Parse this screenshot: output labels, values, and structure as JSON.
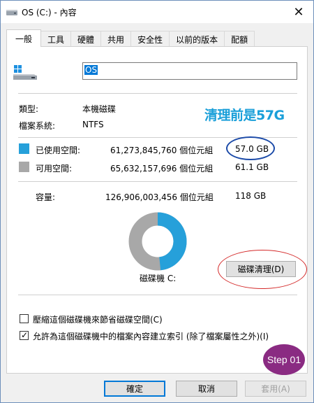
{
  "window": {
    "title": "OS (C:) - 內容",
    "close_glyph": "✕"
  },
  "tabs": [
    "一般",
    "工具",
    "硬體",
    "共用",
    "安全性",
    "以前的版本",
    "配額"
  ],
  "drive_name": "OS",
  "info": {
    "type_label": "類型:",
    "type_value": "本機磁碟",
    "fs_label": "檔案系統:",
    "fs_value": "NTFS"
  },
  "used": {
    "label": "已使用空間:",
    "bytes": "61,273,845,760 個位元組",
    "size": "57.0 GB",
    "color": "#26a0da"
  },
  "free": {
    "label": "可用空間:",
    "bytes": "65,632,157,696 個位元組",
    "size": "61.1 GB",
    "color": "#a8a8a8"
  },
  "capacity": {
    "label": "容量:",
    "bytes": "126,906,003,456 個位元組",
    "size": "118 GB"
  },
  "drive_label": "磁碟機 C:",
  "cleanup_button": "磁碟清理(D)",
  "options": [
    {
      "label": "壓縮這個磁碟機來節省磁碟空間(C)",
      "checked": false
    },
    {
      "label": "允許為這個磁碟機中的檔案內容建立索引 (除了檔案屬性之外)(I)",
      "checked": true
    }
  ],
  "annotation": {
    "note": "清理前是57G",
    "step": "Step 01"
  },
  "buttons": {
    "ok": "確定",
    "cancel": "取消",
    "apply": "套用(A)"
  },
  "usage_fraction": 0.483
}
